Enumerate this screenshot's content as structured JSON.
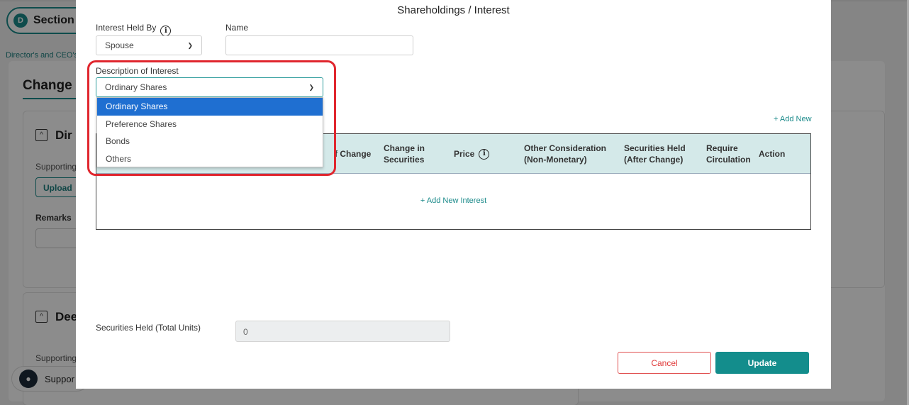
{
  "background": {
    "section_badge": "D",
    "section_label": "Section",
    "breadcrumb": "Director's and CEO's",
    "card_title": "Change i",
    "panel1_title": "Dir",
    "supporting_label": "Supporting",
    "upload_label": "Upload",
    "remarks_label": "Remarks",
    "panel2_title": "Dee",
    "supporting_label2": "Supporting",
    "support_label": "Suppor"
  },
  "modal": {
    "title": "Shareholdings / Interest",
    "interest_held_by": {
      "label": "Interest Held By",
      "value": "Spouse"
    },
    "name": {
      "label": "Name",
      "value": ""
    },
    "description": {
      "label": "Description of Interest",
      "value": "Ordinary Shares",
      "options": [
        "Ordinary Shares",
        "Preference Shares",
        "Bonds",
        "Others"
      ],
      "selected_index": 0
    },
    "add_new": "+ Add New",
    "table": {
      "headers": {
        "nature_partial": "f Change",
        "change_in_securities": "Change in Securities",
        "price": "Price",
        "other_consideration": "Other Consideration (Non-Monetary)",
        "securities_held": "Securities Held (After Change)",
        "require_circulation": "Require Circulation",
        "action": "Action"
      },
      "change_in_securities_l1": "Change in",
      "change_in_securities_l2": "Securities",
      "other_consideration_l1": "Other Consideration",
      "other_consideration_l2": "(Non-Monetary)",
      "securities_held_l1": "Securities Held",
      "securities_held_l2": "(After Change)",
      "require_circulation_l1": "Require",
      "require_circulation_l2": "Circulation",
      "add_interest": "+ Add New Interest"
    },
    "total_units": {
      "label": "Securities Held (Total Units)",
      "value": "0"
    },
    "cancel_label": "Cancel",
    "update_label": "Update"
  },
  "colors": {
    "accent": "#138d8c",
    "highlight": "#e0262e",
    "selected_option": "#1f6fd1",
    "table_header": "#d4e9e9"
  }
}
